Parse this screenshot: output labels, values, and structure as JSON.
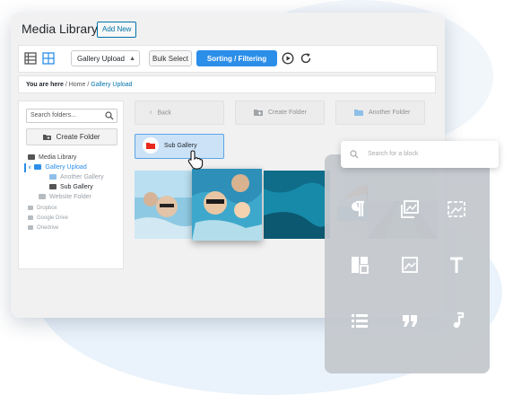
{
  "app": {
    "title": "Media Library",
    "add_new_label": "Add New"
  },
  "toolbar": {
    "list_view_icon": "list-view-icon",
    "grid_view_icon": "grid-view-icon",
    "select_value": "Gallery Upload",
    "bulk_select_label": "Bulk Select",
    "sorting_label": "Sorting / Filtering",
    "play_icon": "play-icon",
    "refresh_icon": "refresh-icon",
    "accent_color": "#2b8ee9"
  },
  "breadcrumb": {
    "prefix": "You are here",
    "items": [
      "Home",
      "Gallery Upload"
    ]
  },
  "sidebar": {
    "search_placeholder": "Search folders...",
    "create_folder_label": "Create Folder",
    "tree": [
      {
        "label": "Media Library"
      },
      {
        "label": "Gallery Upload"
      },
      {
        "label": "Another Gallery"
      },
      {
        "label": "Sub Gallery"
      },
      {
        "label": "Website Folder"
      },
      {
        "label": "Dropbox"
      },
      {
        "label": "Google Drive"
      },
      {
        "label": "Onedrive"
      }
    ]
  },
  "content": {
    "back_label": "Back",
    "create_folder_label": "Create Folder",
    "another_folder_label": "Another Folder",
    "sub_gallery_label": "Sub Gallery"
  },
  "blocks": {
    "search_placeholder": "Search for a block",
    "icons": [
      "paragraph-icon",
      "gallery-icon",
      "cover-icon",
      "columns-icon",
      "image-icon",
      "heading-icon",
      "list-icon",
      "quote-icon",
      "audio-icon"
    ]
  }
}
